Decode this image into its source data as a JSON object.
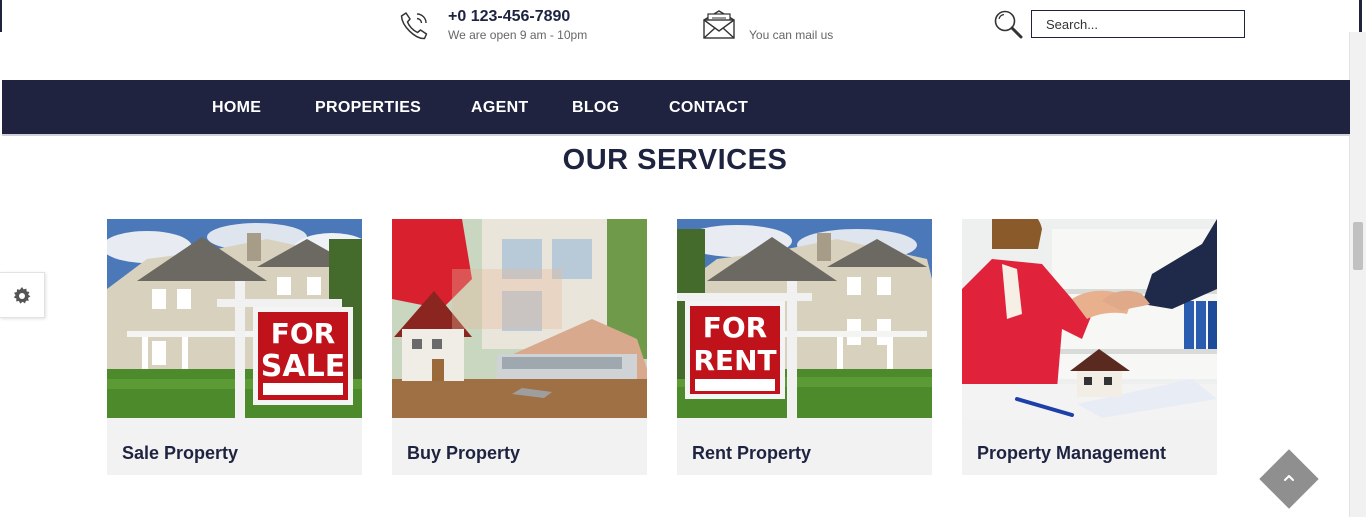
{
  "header": {
    "phone": "+0 123-456-7890",
    "hours": "We are open 9 am - 10pm",
    "mail_text": "You can mail us",
    "search_placeholder": "Search...",
    "icons": {
      "phone": "phone-icon",
      "mail": "envelope-icon",
      "search": "search-icon"
    }
  },
  "nav": {
    "items": [
      {
        "label": "HOME"
      },
      {
        "label": "PROPERTIES"
      },
      {
        "label": "AGENT"
      },
      {
        "label": "BLOG"
      },
      {
        "label": "CONTACT"
      }
    ]
  },
  "services": {
    "title": "OUR SERVICES",
    "cards": [
      {
        "title": "Sale Property",
        "sign": [
          "FOR",
          "SALE"
        ]
      },
      {
        "title": "Buy Property"
      },
      {
        "title": "Rent Property",
        "sign": [
          "FOR",
          "RENT"
        ]
      },
      {
        "title": "Property Management"
      }
    ]
  },
  "widgets": {
    "settings_icon": "gear-icon",
    "back_to_top_icon": "chevron-up-icon"
  },
  "colors": {
    "navy": "#1f2340",
    "card_bg": "#f2f2f2",
    "sign_red": "#b8141c",
    "to_top": "#8f8f8f"
  }
}
